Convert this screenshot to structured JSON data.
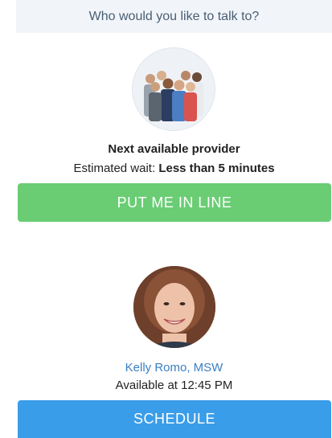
{
  "header": {
    "title": "Who would you like to talk to?"
  },
  "next_provider": {
    "avatar_icon": "provider-group-photo",
    "title": "Next available provider",
    "wait_label": "Estimated wait:",
    "wait_value": "Less than 5 minutes",
    "button_label": "PUT ME IN LINE"
  },
  "specific_provider": {
    "avatar_icon": "provider-portrait-photo",
    "name": "Kelly Romo, MSW",
    "availability": "Available at 12:45 PM",
    "button_label": "SCHEDULE"
  },
  "colors": {
    "header_bg": "#f1f5f9",
    "line_button": "#6acd74",
    "schedule_button": "#3a9de9",
    "name_link": "#3a7fc1"
  }
}
